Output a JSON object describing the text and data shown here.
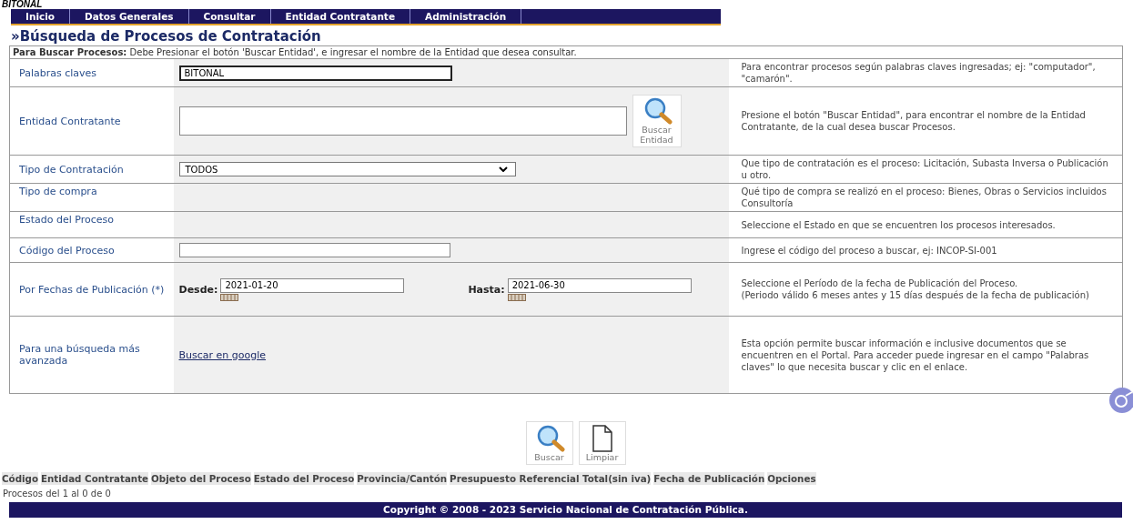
{
  "top_text": "BITONAL",
  "nav": [
    {
      "label": "Inicio"
    },
    {
      "label": "Datos Generales"
    },
    {
      "label": "Consultar"
    },
    {
      "label": "Entidad Contratante"
    },
    {
      "label": "Administración"
    }
  ],
  "title": "»Búsqueda de Procesos de Contratación",
  "instructions": "**Para Buscar Procesos:** Debe Presionar el botón 'Buscar Entidad', e ingresar el nombre de la Entidad que desea consultar.",
  "rows": [
    {
      "kind": "text",
      "label": "Palabras claves",
      "value": "BITONAL",
      "help": "Para encontrar procesos según palabras claves ingresadas; ej: \"computador\", \"camarón\"."
    },
    {
      "kind": "textarea",
      "label": "Entidad Contratante",
      "button": "Buscar Entidad",
      "help": "Presione el botón \"Buscar Entidad\", para encontrar el nombre de la Entidad Contratante, de la cual desea buscar Procesos."
    },
    {
      "kind": "select",
      "label": "Tipo de Contratación",
      "value": "TODOS",
      "help": "Que tipo de contratación es el proceso: Licitación, Subasta Inversa o Publicación u otro."
    },
    {
      "kind": "empty",
      "label": "Tipo de compra",
      "help": "Qué tipo de compra se realizó en el proceso: Bienes, Obras o Servicios incluidos Consultoría"
    },
    {
      "kind": "empty",
      "label": "Estado del Proceso",
      "help": "Seleccione el Estado en que se encuentren los procesos interesados."
    },
    {
      "kind": "code",
      "label": "Código del Proceso",
      "help": "Ingrese el código del proceso a buscar, ej: INCOP-SI-001"
    },
    {
      "kind": "dates",
      "label": "Por Fechas de Publicación (*)",
      "from_label": "Desde:",
      "from_value": "2021-01-20",
      "to_label": "Hasta:",
      "to_value": "2021-06-30",
      "help": "Seleccione el Período de la fecha de Publicación del Proceso.",
      "help_note": "(Periodo válido 6 meses antes y 15 días después de la fecha de publicación)"
    },
    {
      "kind": "link",
      "label": "Para una búsqueda más avanzada",
      "link": "Buscar en google",
      "help": "Esta opción permite buscar información e inclusive documentos que se encuentren en el Portal. Para acceder puede ingresar en el campo \"Palabras claves\" lo que necesita buscar y clic en el enlace."
    }
  ],
  "actions": [
    {
      "kind": "search",
      "label": "Buscar"
    },
    {
      "kind": "clear",
      "label": "Limpiar"
    }
  ],
  "columns": [
    "Código",
    "Entidad Contratante",
    "Objeto del Proceso",
    "Estado del Proceso",
    "Provincia/Cantón",
    "Presupuesto Referencial Total(sin iva)",
    "Fecha de Publicación",
    "Opciones"
  ],
  "count": "Procesos del 1 al 0 de 0",
  "footer": "Copyright © 2008 - 2023 Servicio Nacional de Contratación Pública."
}
